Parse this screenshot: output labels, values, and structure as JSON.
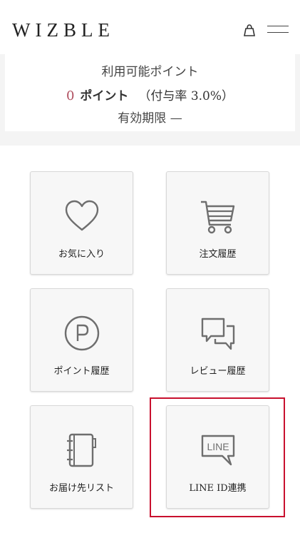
{
  "header": {
    "logo": "WIZBLE",
    "bag_icon": "shopping-bag-icon",
    "menu_icon": "hamburger-menu-icon"
  },
  "points": {
    "title": "利用可能ポイント",
    "value": "0",
    "unit": "ポイント",
    "rate": "（付与率 3.0%）",
    "expiry": "有効期限 —"
  },
  "tiles": [
    {
      "label": "お気に入り",
      "icon": "heart-icon"
    },
    {
      "label": "注文履歴",
      "icon": "shopping-cart-icon"
    },
    {
      "label": "ポイント履歴",
      "icon": "points-p-icon"
    },
    {
      "label": "レビュー履歴",
      "icon": "chat-bubbles-icon"
    },
    {
      "label": "お届け先リスト",
      "icon": "address-book-icon"
    },
    {
      "label": "LINE ID連携",
      "icon": "line-icon",
      "icon_text": "LINE"
    }
  ],
  "colors": {
    "points_value": "#b05060",
    "highlight": "#c8102e",
    "icon_stroke": "#6e6e6e"
  }
}
